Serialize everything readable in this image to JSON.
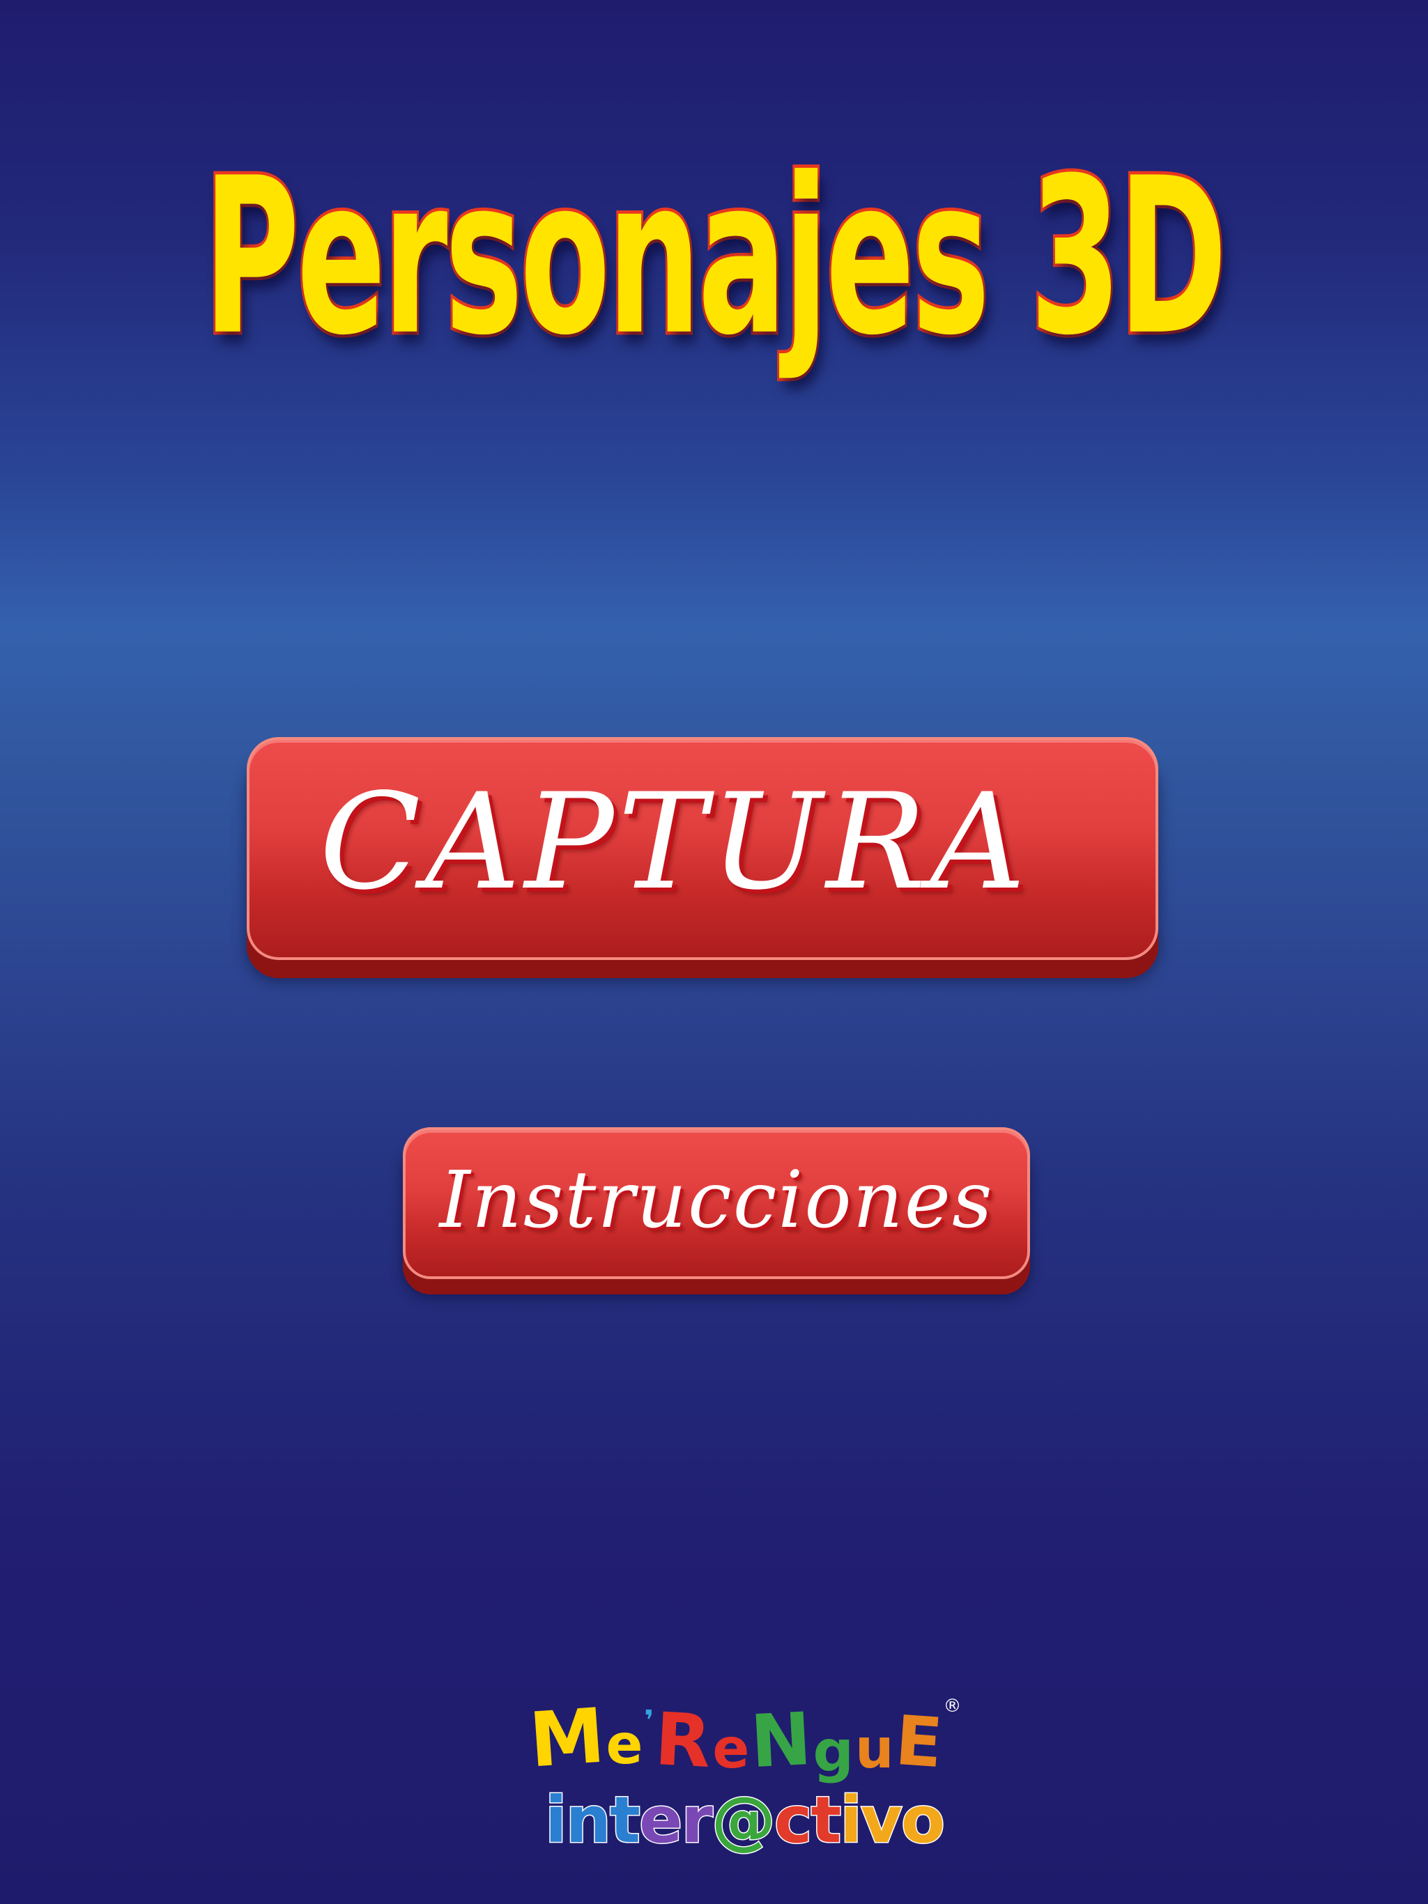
{
  "title": "Personajes 3D",
  "buttons": {
    "capture_label": "CAPTURA",
    "instructions_label": "Instrucciones"
  },
  "logo": {
    "brand_letters": [
      "M",
      "e",
      "R",
      "e",
      "N",
      "g",
      "u",
      "E"
    ],
    "registered_mark": "®",
    "sub_letters": [
      "i",
      "n",
      "t",
      "e",
      "r",
      "@",
      "c",
      "t",
      "i",
      "v",
      "o"
    ]
  },
  "colors": {
    "background_dark": "#1f1c6e",
    "background_band": "#3461ad",
    "title_fill": "#ffe400",
    "title_outline": "#e9381f",
    "button_red": "#e2403f",
    "button_text": "#ffffff"
  }
}
